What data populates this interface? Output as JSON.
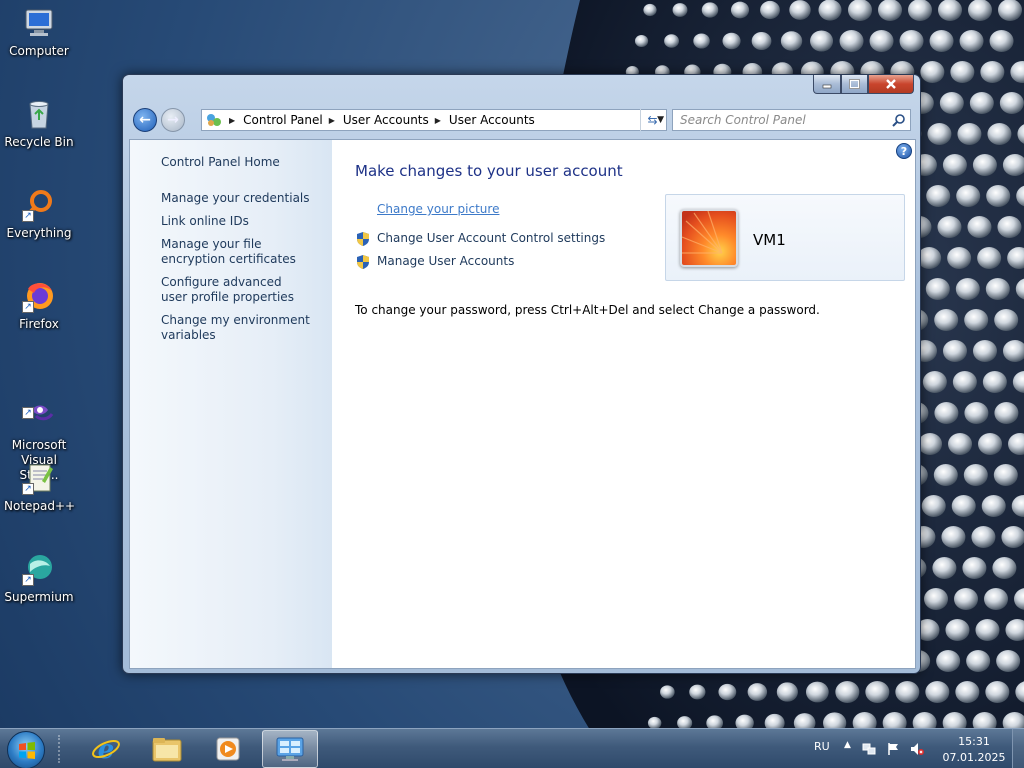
{
  "desktop": {
    "icons": [
      {
        "label": "Computer"
      },
      {
        "label": "Recycle Bin"
      },
      {
        "label": "Everything"
      },
      {
        "label": "Firefox"
      },
      {
        "label": "Microsoft\nVisual Stud..."
      },
      {
        "label": "Notepad++"
      },
      {
        "label": "Supermium"
      }
    ]
  },
  "window": {
    "address": {
      "crumbs": [
        "Control Panel",
        "User Accounts",
        "User Accounts"
      ]
    },
    "search": {
      "placeholder": "Search Control Panel"
    },
    "left_pane": {
      "home": "Control Panel Home",
      "links": [
        "Manage your credentials",
        "Link online IDs",
        "Manage your file encryption certificates",
        "Configure advanced user profile properties",
        "Change my environment variables"
      ]
    },
    "main": {
      "title": "Make changes to your user account",
      "tasks": [
        "Change your picture",
        "Change User Account Control settings",
        "Manage User Accounts"
      ],
      "password_note": "To change your password, press Ctrl+Alt+Del and select Change a password.",
      "user_name": "VM1"
    }
  },
  "taskbar": {
    "language": "RU",
    "time": "15:31",
    "date": "07.01.2025"
  },
  "colors": {
    "link": "#1e395b",
    "title": "#1e3287",
    "visited_link": "#3d7ac9"
  }
}
